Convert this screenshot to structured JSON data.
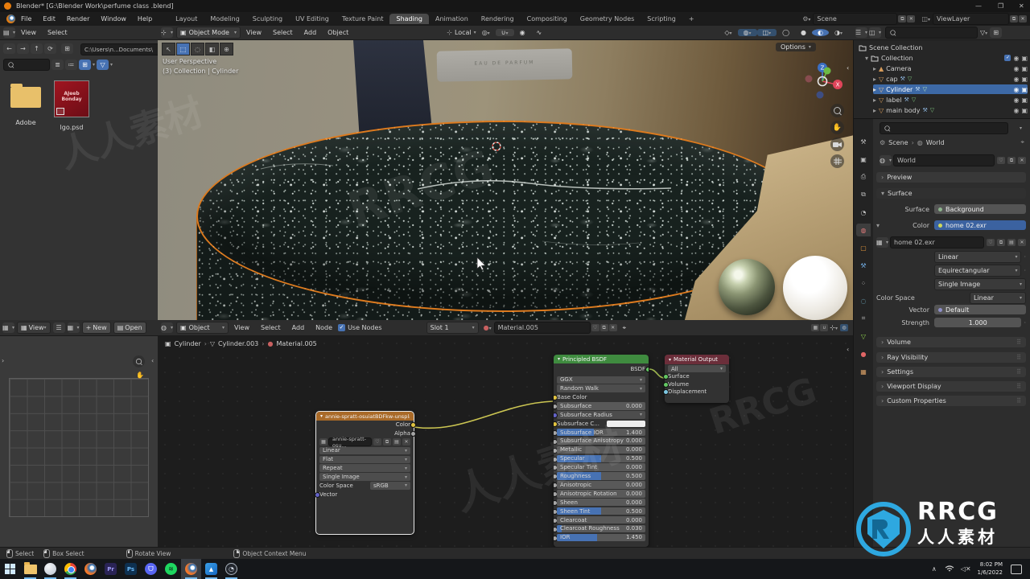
{
  "win": {
    "title": "Blender* [G:\\Blender Work\\perfume class .blend]"
  },
  "top": {
    "menus": [
      "File",
      "Edit",
      "Render",
      "Window",
      "Help"
    ],
    "tabs": [
      "Layout",
      "Modeling",
      "Sculpting",
      "UV Editing",
      "Texture Paint",
      "Shading",
      "Animation",
      "Rendering",
      "Compositing",
      "Geometry Nodes",
      "Scripting"
    ],
    "plus": "+",
    "scene": "Scene",
    "viewlayer": "ViewLayer"
  },
  "fb": {
    "menus": [
      "View",
      "Select"
    ],
    "path": "C:\\Users\\n...Documents\\",
    "folder": "Adobe",
    "file": "lgo.psd",
    "thumb1": "AJeeb",
    "thumb2": "Bonday"
  },
  "vp": {
    "mode": "Object Mode",
    "menus": [
      "View",
      "Select",
      "Add",
      "Object"
    ],
    "orient": "Local",
    "persp": "User Perspective",
    "coll": "(3) Collection | Cylinder",
    "options": "Options",
    "label": "EAU DE PARFUM"
  },
  "ol": {
    "title": "Scene Collection",
    "coll": "Collection",
    "items": [
      "Camera",
      "cap",
      "Cylinder",
      "label",
      "main body"
    ]
  },
  "pr": {
    "scene": "Scene",
    "world": "World",
    "block": "World",
    "preview": "Preview",
    "surface": "Surface",
    "surface_l": "Surface",
    "surface_v": "Background",
    "color_l": "Color",
    "color_v": "home 02.exr",
    "image": "home 02.exr",
    "interp": "Linear",
    "proj": "Equirectangular",
    "src": "Single Image",
    "cs_l": "Color Space",
    "cs_v": "Linear",
    "vec_l": "Vector",
    "vec_v": "Default",
    "str_l": "Strength",
    "str_v": "1.000",
    "sections": [
      "Volume",
      "Ray Visibility",
      "Settings",
      "Viewport Display",
      "Custom Properties"
    ]
  },
  "ie": {
    "view": "View",
    "new": "New",
    "open": "Open"
  },
  "se": {
    "obj": "Object",
    "menus": [
      "View",
      "Select",
      "Add",
      "Node"
    ],
    "use": "Use Nodes",
    "slot": "Slot 1",
    "mat": "Material.005",
    "bc": [
      "Cylinder",
      "Cylinder.003",
      "Material.005"
    ]
  },
  "n": {
    "img": {
      "title": "annie-spratt-osuiatBDFkw-unsplash.jpg",
      "color": "Color",
      "alpha": "Alpha",
      "block": "annie-spratt-osu...",
      "interp": "Linear",
      "proj": "Flat",
      "ext": "Repeat",
      "src": "Single Image",
      "cs_l": "Color Space",
      "cs_v": "sRGB",
      "vec": "Vector"
    },
    "p": {
      "title": "Principled BSDF",
      "out": "BSDF",
      "dist": "GGX",
      "method": "Random Walk",
      "base": "Base Color",
      "radius": "Subsurface Radius",
      "subc": "Subsurface C...",
      "params": [
        {
          "l": "Subsurface",
          "v": "0.000",
          "f": 0
        },
        {
          "l": "Subsurface IOR",
          "v": "1.400",
          "f": 0.42
        },
        {
          "l": "Subsurface Anisotropy",
          "v": "0.000",
          "f": 0
        },
        {
          "l": "Metallic",
          "v": "0.000",
          "f": 0
        },
        {
          "l": "Specular",
          "v": "0.500",
          "f": 0.5
        },
        {
          "l": "Specular Tint",
          "v": "0.000",
          "f": 0
        },
        {
          "l": "Roughness",
          "v": "0.500",
          "f": 0.5
        },
        {
          "l": "Anisotropic",
          "v": "0.000",
          "f": 0
        },
        {
          "l": "Anisotropic Rotation",
          "v": "0.000",
          "f": 0
        },
        {
          "l": "Sheen",
          "v": "0.000",
          "f": 0
        },
        {
          "l": "Sheen Tint",
          "v": "0.500",
          "f": 0.5
        },
        {
          "l": "Clearcoat",
          "v": "0.000",
          "f": 0
        },
        {
          "l": "Clearcoat Roughness",
          "v": "0.030",
          "f": 0.05
        },
        {
          "l": "IOR",
          "v": "1.450",
          "f": 0.45
        }
      ]
    },
    "o": {
      "title": "Material Output",
      "all": "All",
      "in": [
        "Surface",
        "Volume",
        "Displacement"
      ]
    }
  },
  "sb": {
    "items": [
      "Select",
      "Box Select",
      "Rotate View",
      "Object Context Menu"
    ]
  },
  "tb": {
    "pr": "Pr",
    "ps": "Ps",
    "time": "8:02 PM",
    "date": "1/6/2022"
  },
  "wm": {
    "brand": "RRCG",
    "cn": "人人素材"
  },
  "colors": {
    "accent": "#4772b3",
    "select_orange": "#ff8a1e",
    "node_green": "#3f8b3f",
    "node_red": "#6b2e3a",
    "node_orange": "#a96a28"
  }
}
